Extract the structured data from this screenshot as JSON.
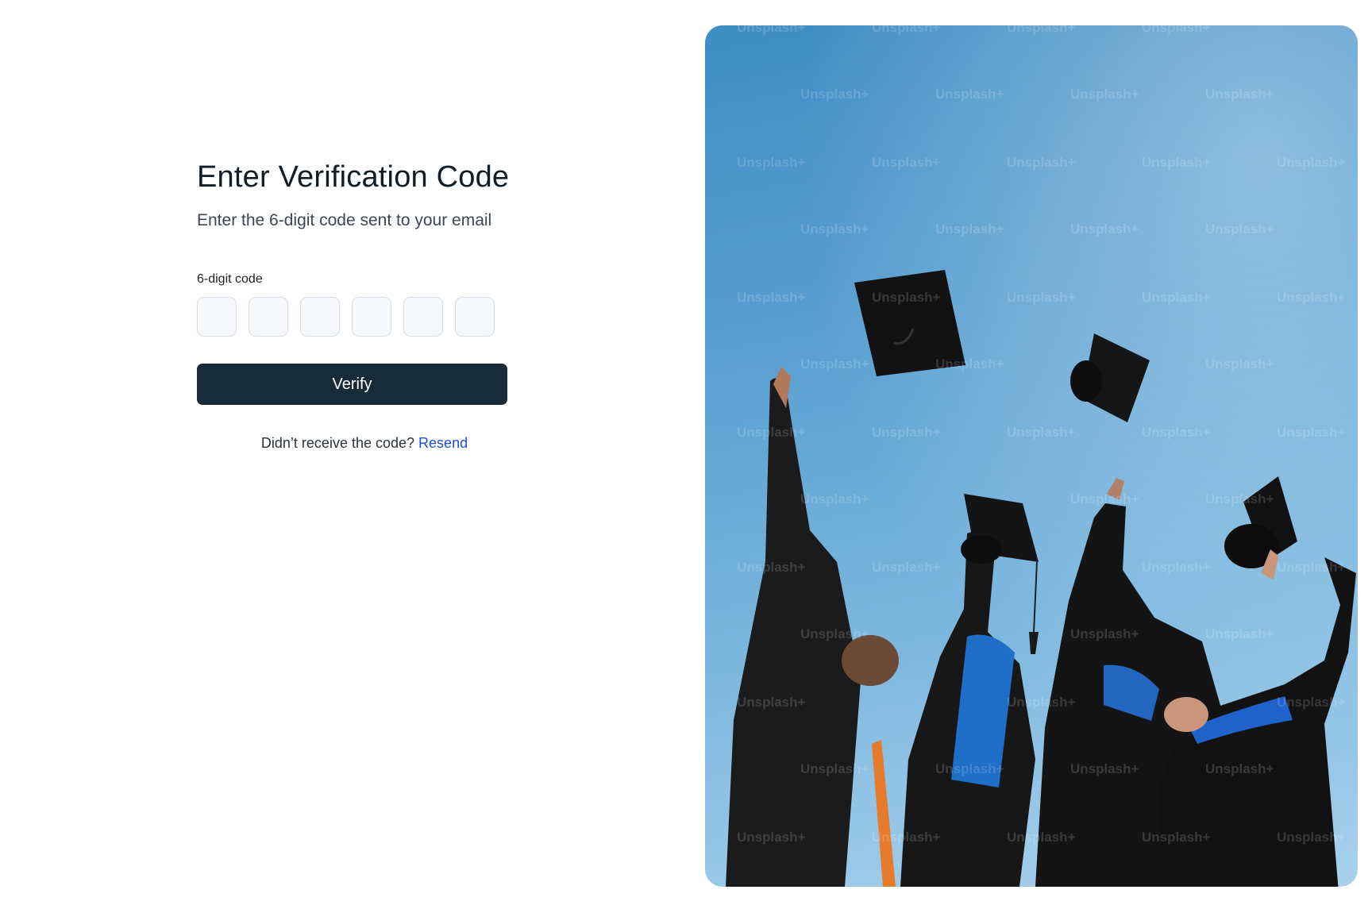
{
  "form": {
    "title": "Enter Verification Code",
    "subtitle": "Enter the 6-digit code sent to your email",
    "code_label": "6-digit code",
    "code_digits": [
      "",
      "",
      "",
      "",
      "",
      ""
    ],
    "verify_label": "Verify",
    "resend_prompt": "Didn’t receive the code?",
    "resend_link": "Resend"
  },
  "photo": {
    "watermark": "Unsplash+"
  },
  "colors": {
    "button": "#182b38",
    "link": "#1d4fd8",
    "input_bg": "#f6f8fb",
    "input_border": "#d6dde6"
  }
}
